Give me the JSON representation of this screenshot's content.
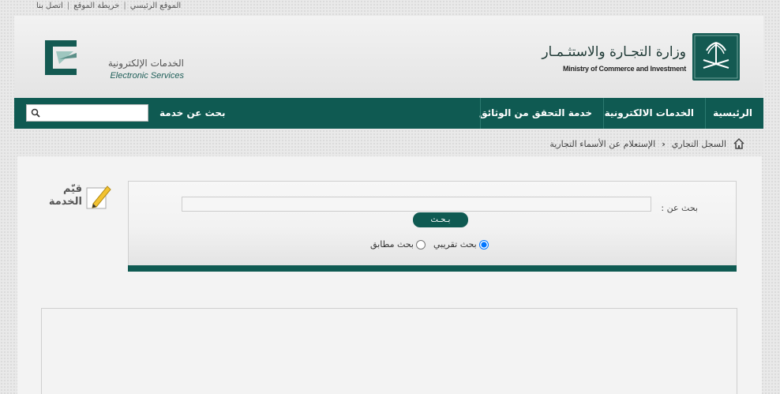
{
  "top_links": {
    "home": "الموقع الرئيسي",
    "sitemap": "خريطة الموقع",
    "contact": "اتصل بنا"
  },
  "logos": {
    "services_ar": "الخدمات الإلكترونية",
    "services_en": "Electronic Services",
    "ministry_ar": "وزارة التجـارة والاستثـمـار",
    "ministry_en": "Ministry of Commerce and Investment"
  },
  "nav": {
    "items": [
      {
        "label": "الرئيسية"
      },
      {
        "label": "الخدمات الالكترونية"
      },
      {
        "label": "خدمة التحقق من الوثائق"
      }
    ],
    "search_label": "بحث عن خدمة",
    "search_placeholder": ""
  },
  "breadcrumb": {
    "items": [
      "السجل التجاري",
      "الإستعلام عن الأسماء التجارية"
    ]
  },
  "rate": {
    "line1": "قيّم",
    "line2": "الخدمة"
  },
  "search_panel": {
    "label": "بحث عن :",
    "query_value": "",
    "button_label": "بـحـث",
    "radio_approx": "بحث تقريبي",
    "radio_exact": "بحث مطابق",
    "selected": "approx"
  },
  "colors": {
    "brand_green": "#0f5a52"
  }
}
